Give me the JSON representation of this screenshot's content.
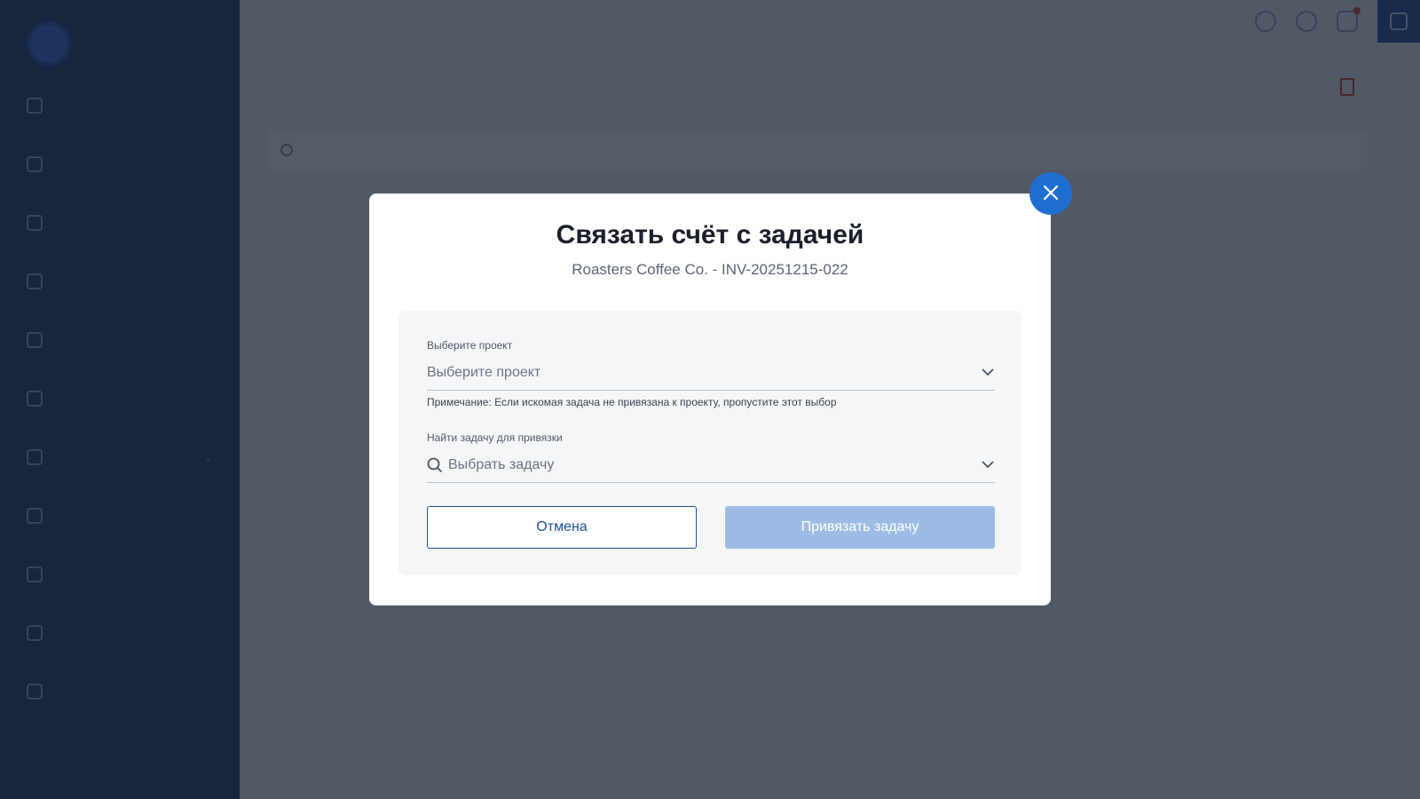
{
  "modal": {
    "title": "Связать счёт с задачей",
    "subtitle": "Roasters Coffee Co. - INV-20251215-022",
    "project_label": "Выберите проект",
    "project_placeholder": "Выберите проект",
    "note": "Примечание: Если искомая задача не привязана к проекту, пропустите этот выбор",
    "task_label": "Найти задачу для привязки",
    "task_placeholder": "Выбрать задачу",
    "cancel_label": "Отмена",
    "submit_label": "Привязать задачу"
  },
  "colors": {
    "accent": "#1f6fd1",
    "primary_button_disabled": "#9cbce5",
    "sidebar": "#1f3b6e"
  }
}
